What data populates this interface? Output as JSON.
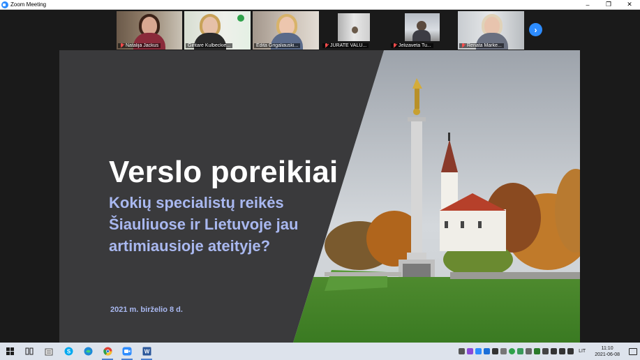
{
  "window": {
    "title": "Zoom Meeting",
    "minimize": "–",
    "restore": "❐",
    "close": "✕"
  },
  "participants": [
    {
      "name": "Natalija Jackus",
      "muted": true,
      "active": false
    },
    {
      "name": "Gintarė Kulbeckie...",
      "muted": false,
      "active": true
    },
    {
      "name": "Edita Grigaliauski...",
      "muted": false,
      "active": false
    },
    {
      "name": "JŪRATĖ VALU...",
      "muted": true,
      "active": false
    },
    {
      "name": "Jelizaveta Tu...",
      "muted": true,
      "active": false
    },
    {
      "name": "Renata Marke...",
      "muted": true,
      "active": false
    }
  ],
  "next_page_glyph": "›",
  "slide": {
    "title": "Verslo poreikiai",
    "subtitle": "Kokių specialistų reikės Šiauliuose ir Lietuvoje jau artimiausioje ateityje?",
    "date": "2021 m. birželio 8 d."
  },
  "taskbar": {
    "apps": [
      "windows-start",
      "task-view",
      "notepad",
      "skype",
      "edge",
      "chrome",
      "zoom",
      "word"
    ],
    "language": "LIT",
    "time": "11:10",
    "date": "2021-06-08"
  },
  "colors": {
    "accent": "#2d8cff",
    "slide_bg": "#3a3a3c",
    "subtitle": "#a9b8f0",
    "active_speaker": "#8aff8a"
  }
}
